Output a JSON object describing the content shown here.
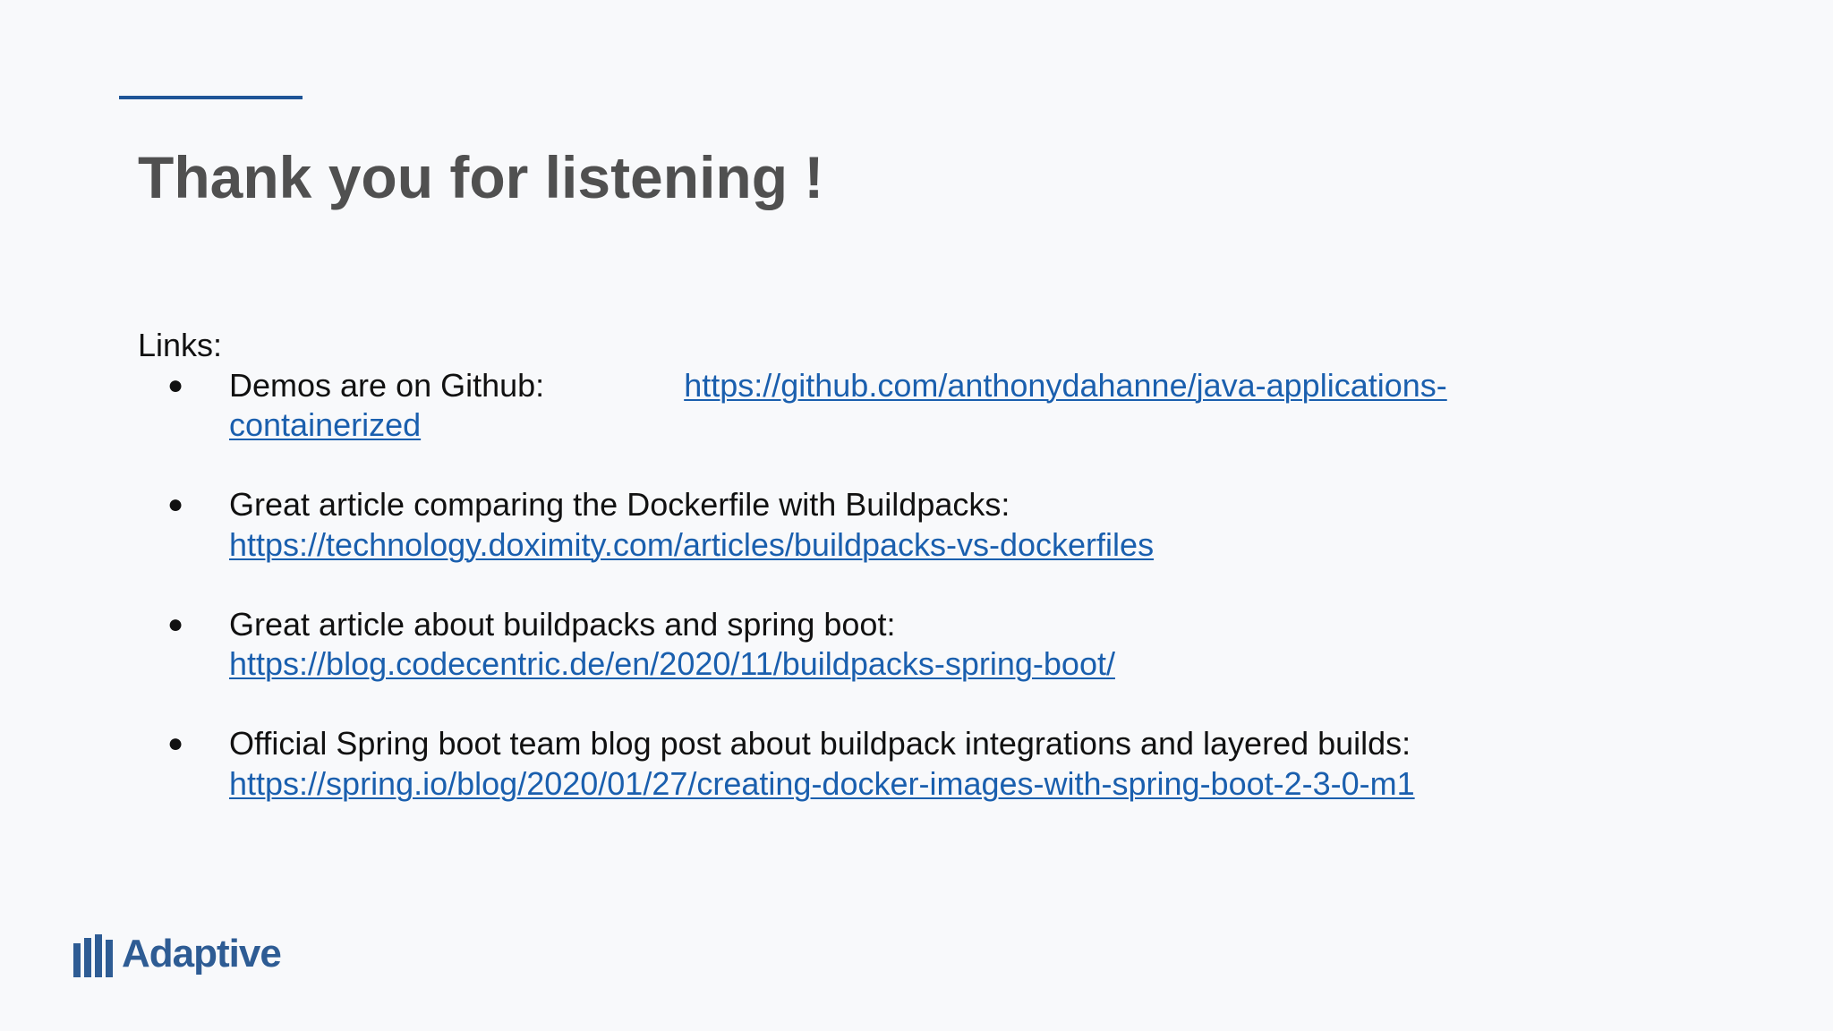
{
  "slide": {
    "title": "Thank you for listening !",
    "links_heading": "Links:",
    "bullet_glyph": "●",
    "accent_color": "#1f5597",
    "link_color": "#1a5fae",
    "items": [
      {
        "text": "Demos are on Github:",
        "url_line1": "https://github.com/anthonydahanne/java-applications-",
        "url_line2": "containerized"
      },
      {
        "text": "Great article comparing the Dockerfile with Buildpacks:",
        "url": "https://technology.doximity.com/articles/buildpacks-vs-dockerfiles"
      },
      {
        "text": "Great article about buildpacks and spring boot:",
        "url": "https://blog.codecentric.de/en/2020/11/buildpacks-spring-boot/"
      },
      {
        "text": "Official Spring boot team blog post about buildpack integrations and layered builds:",
        "url": "https://spring.io/blog/2020/01/27/creating-docker-images-with-spring-boot-2-3-0-m1"
      }
    ]
  },
  "branding": {
    "logo_text": "Adaptive",
    "logo_icon": "bars-logo-icon",
    "logo_color": "#2e5c94"
  }
}
